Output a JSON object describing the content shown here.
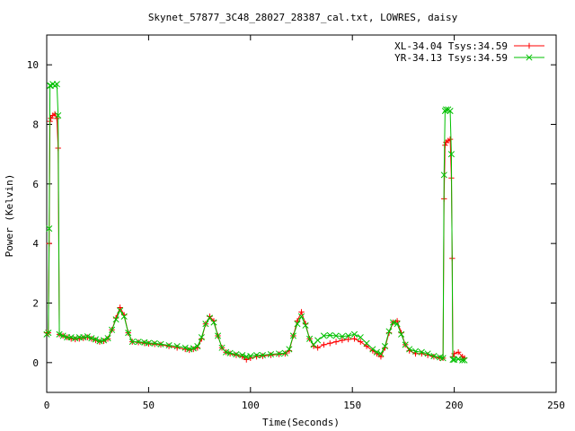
{
  "chart_data": {
    "type": "line",
    "title": "Skynet_57877_3C48_28027_28387_cal.txt, LOWRES, daisy",
    "xlabel": "Time(Seconds)",
    "ylabel": "Power (Kelvin)",
    "xlim": [
      0,
      250
    ],
    "ylim": [
      -1,
      11
    ],
    "xticks": [
      0,
      50,
      100,
      150,
      200,
      250
    ],
    "yticks": [
      0,
      2,
      4,
      6,
      8,
      10
    ],
    "grid": false,
    "legend_position": "top-right",
    "series": [
      {
        "name": "XL-34.04 Tsys:34.59",
        "color": "#ff0000",
        "marker": "plus",
        "points": [
          [
            0,
            1.0
          ],
          [
            0.8,
            1.0
          ],
          [
            1.2,
            4.0
          ],
          [
            1.6,
            8.1
          ],
          [
            2.0,
            8.2
          ],
          [
            3.0,
            8.3
          ],
          [
            4.0,
            8.35
          ],
          [
            5.0,
            8.2
          ],
          [
            5.6,
            7.2
          ],
          [
            6.2,
            0.95
          ],
          [
            8,
            0.9
          ],
          [
            10,
            0.85
          ],
          [
            12,
            0.8
          ],
          [
            14,
            0.78
          ],
          [
            16,
            0.8
          ],
          [
            18,
            0.82
          ],
          [
            20,
            0.85
          ],
          [
            22,
            0.8
          ],
          [
            24,
            0.75
          ],
          [
            26,
            0.7
          ],
          [
            28,
            0.72
          ],
          [
            30,
            0.8
          ],
          [
            32,
            1.1
          ],
          [
            34,
            1.5
          ],
          [
            36,
            1.85
          ],
          [
            38,
            1.6
          ],
          [
            40,
            1.0
          ],
          [
            42,
            0.7
          ],
          [
            45,
            0.68
          ],
          [
            48,
            0.65
          ],
          [
            50,
            0.63
          ],
          [
            53,
            0.62
          ],
          [
            56,
            0.6
          ],
          [
            60,
            0.55
          ],
          [
            64,
            0.5
          ],
          [
            68,
            0.45
          ],
          [
            70,
            0.42
          ],
          [
            72,
            0.45
          ],
          [
            74,
            0.5
          ],
          [
            76,
            0.8
          ],
          [
            78,
            1.3
          ],
          [
            80,
            1.55
          ],
          [
            82,
            1.4
          ],
          [
            84,
            0.9
          ],
          [
            86,
            0.5
          ],
          [
            88,
            0.35
          ],
          [
            90,
            0.3
          ],
          [
            93,
            0.25
          ],
          [
            96,
            0.2
          ],
          [
            98,
            0.1
          ],
          [
            100,
            0.15
          ],
          [
            103,
            0.2
          ],
          [
            106,
            0.22
          ],
          [
            110,
            0.25
          ],
          [
            114,
            0.28
          ],
          [
            117,
            0.3
          ],
          [
            119,
            0.4
          ],
          [
            121,
            0.9
          ],
          [
            123,
            1.4
          ],
          [
            125,
            1.7
          ],
          [
            127,
            1.3
          ],
          [
            129,
            0.8
          ],
          [
            131,
            0.55
          ],
          [
            133,
            0.5
          ],
          [
            136,
            0.6
          ],
          [
            139,
            0.65
          ],
          [
            142,
            0.7
          ],
          [
            145,
            0.75
          ],
          [
            148,
            0.78
          ],
          [
            151,
            0.8
          ],
          [
            154,
            0.7
          ],
          [
            157,
            0.55
          ],
          [
            160,
            0.4
          ],
          [
            162,
            0.3
          ],
          [
            164,
            0.2
          ],
          [
            166,
            0.5
          ],
          [
            168,
            1.0
          ],
          [
            170,
            1.35
          ],
          [
            172,
            1.4
          ],
          [
            174,
            1.0
          ],
          [
            176,
            0.6
          ],
          [
            178,
            0.4
          ],
          [
            181,
            0.3
          ],
          [
            184,
            0.3
          ],
          [
            187,
            0.25
          ],
          [
            190,
            0.2
          ],
          [
            193,
            0.15
          ],
          [
            194.5,
            0.15
          ],
          [
            195,
            5.5
          ],
          [
            195.5,
            7.3
          ],
          [
            196,
            7.4
          ],
          [
            197,
            7.45
          ],
          [
            198,
            7.5
          ],
          [
            198.6,
            6.2
          ],
          [
            199,
            3.5
          ],
          [
            199.3,
            0.2
          ],
          [
            200,
            0.3
          ],
          [
            202,
            0.35
          ],
          [
            204,
            0.2
          ],
          [
            205,
            0.15
          ]
        ]
      },
      {
        "name": "YR-34.13 Tsys:34.59",
        "color": "#00c000",
        "marker": "cross",
        "points": [
          [
            0,
            0.95
          ],
          [
            0.8,
            1.0
          ],
          [
            1.2,
            4.5
          ],
          [
            1.6,
            9.3
          ],
          [
            2.0,
            9.3
          ],
          [
            3.0,
            9.35
          ],
          [
            4.0,
            9.3
          ],
          [
            5.0,
            9.35
          ],
          [
            5.6,
            8.3
          ],
          [
            6.2,
            0.95
          ],
          [
            8,
            0.9
          ],
          [
            10,
            0.85
          ],
          [
            12,
            0.85
          ],
          [
            14,
            0.82
          ],
          [
            16,
            0.85
          ],
          [
            18,
            0.85
          ],
          [
            20,
            0.88
          ],
          [
            22,
            0.82
          ],
          [
            24,
            0.78
          ],
          [
            26,
            0.72
          ],
          [
            28,
            0.75
          ],
          [
            30,
            0.82
          ],
          [
            32,
            1.1
          ],
          [
            34,
            1.45
          ],
          [
            36,
            1.75
          ],
          [
            38,
            1.55
          ],
          [
            40,
            1.0
          ],
          [
            42,
            0.7
          ],
          [
            45,
            0.7
          ],
          [
            48,
            0.68
          ],
          [
            50,
            0.66
          ],
          [
            53,
            0.65
          ],
          [
            56,
            0.62
          ],
          [
            60,
            0.58
          ],
          [
            64,
            0.55
          ],
          [
            68,
            0.5
          ],
          [
            70,
            0.45
          ],
          [
            72,
            0.48
          ],
          [
            74,
            0.55
          ],
          [
            76,
            0.85
          ],
          [
            78,
            1.3
          ],
          [
            80,
            1.5
          ],
          [
            82,
            1.35
          ],
          [
            84,
            0.9
          ],
          [
            86,
            0.5
          ],
          [
            88,
            0.35
          ],
          [
            90,
            0.32
          ],
          [
            93,
            0.28
          ],
          [
            96,
            0.25
          ],
          [
            98,
            0.2
          ],
          [
            100,
            0.22
          ],
          [
            103,
            0.25
          ],
          [
            106,
            0.25
          ],
          [
            110,
            0.28
          ],
          [
            114,
            0.3
          ],
          [
            117,
            0.32
          ],
          [
            119,
            0.45
          ],
          [
            121,
            0.9
          ],
          [
            123,
            1.3
          ],
          [
            125,
            1.55
          ],
          [
            127,
            1.25
          ],
          [
            129,
            0.8
          ],
          [
            131,
            0.6
          ],
          [
            133,
            0.75
          ],
          [
            136,
            0.9
          ],
          [
            139,
            0.92
          ],
          [
            142,
            0.9
          ],
          [
            145,
            0.88
          ],
          [
            148,
            0.9
          ],
          [
            151,
            0.95
          ],
          [
            154,
            0.85
          ],
          [
            157,
            0.65
          ],
          [
            160,
            0.45
          ],
          [
            162,
            0.35
          ],
          [
            164,
            0.3
          ],
          [
            166,
            0.55
          ],
          [
            168,
            1.05
          ],
          [
            170,
            1.35
          ],
          [
            172,
            1.3
          ],
          [
            174,
            0.95
          ],
          [
            176,
            0.6
          ],
          [
            178,
            0.45
          ],
          [
            181,
            0.38
          ],
          [
            184,
            0.35
          ],
          [
            187,
            0.3
          ],
          [
            190,
            0.22
          ],
          [
            193,
            0.18
          ],
          [
            194.5,
            0.15
          ],
          [
            195,
            6.3
          ],
          [
            195.5,
            8.45
          ],
          [
            196,
            8.5
          ],
          [
            197,
            8.5
          ],
          [
            198,
            8.45
          ],
          [
            198.6,
            7.0
          ],
          [
            199.3,
            0.1
          ],
          [
            200,
            0.1
          ],
          [
            202,
            0.12
          ],
          [
            204,
            0.08
          ],
          [
            205,
            0.08
          ]
        ]
      }
    ]
  }
}
